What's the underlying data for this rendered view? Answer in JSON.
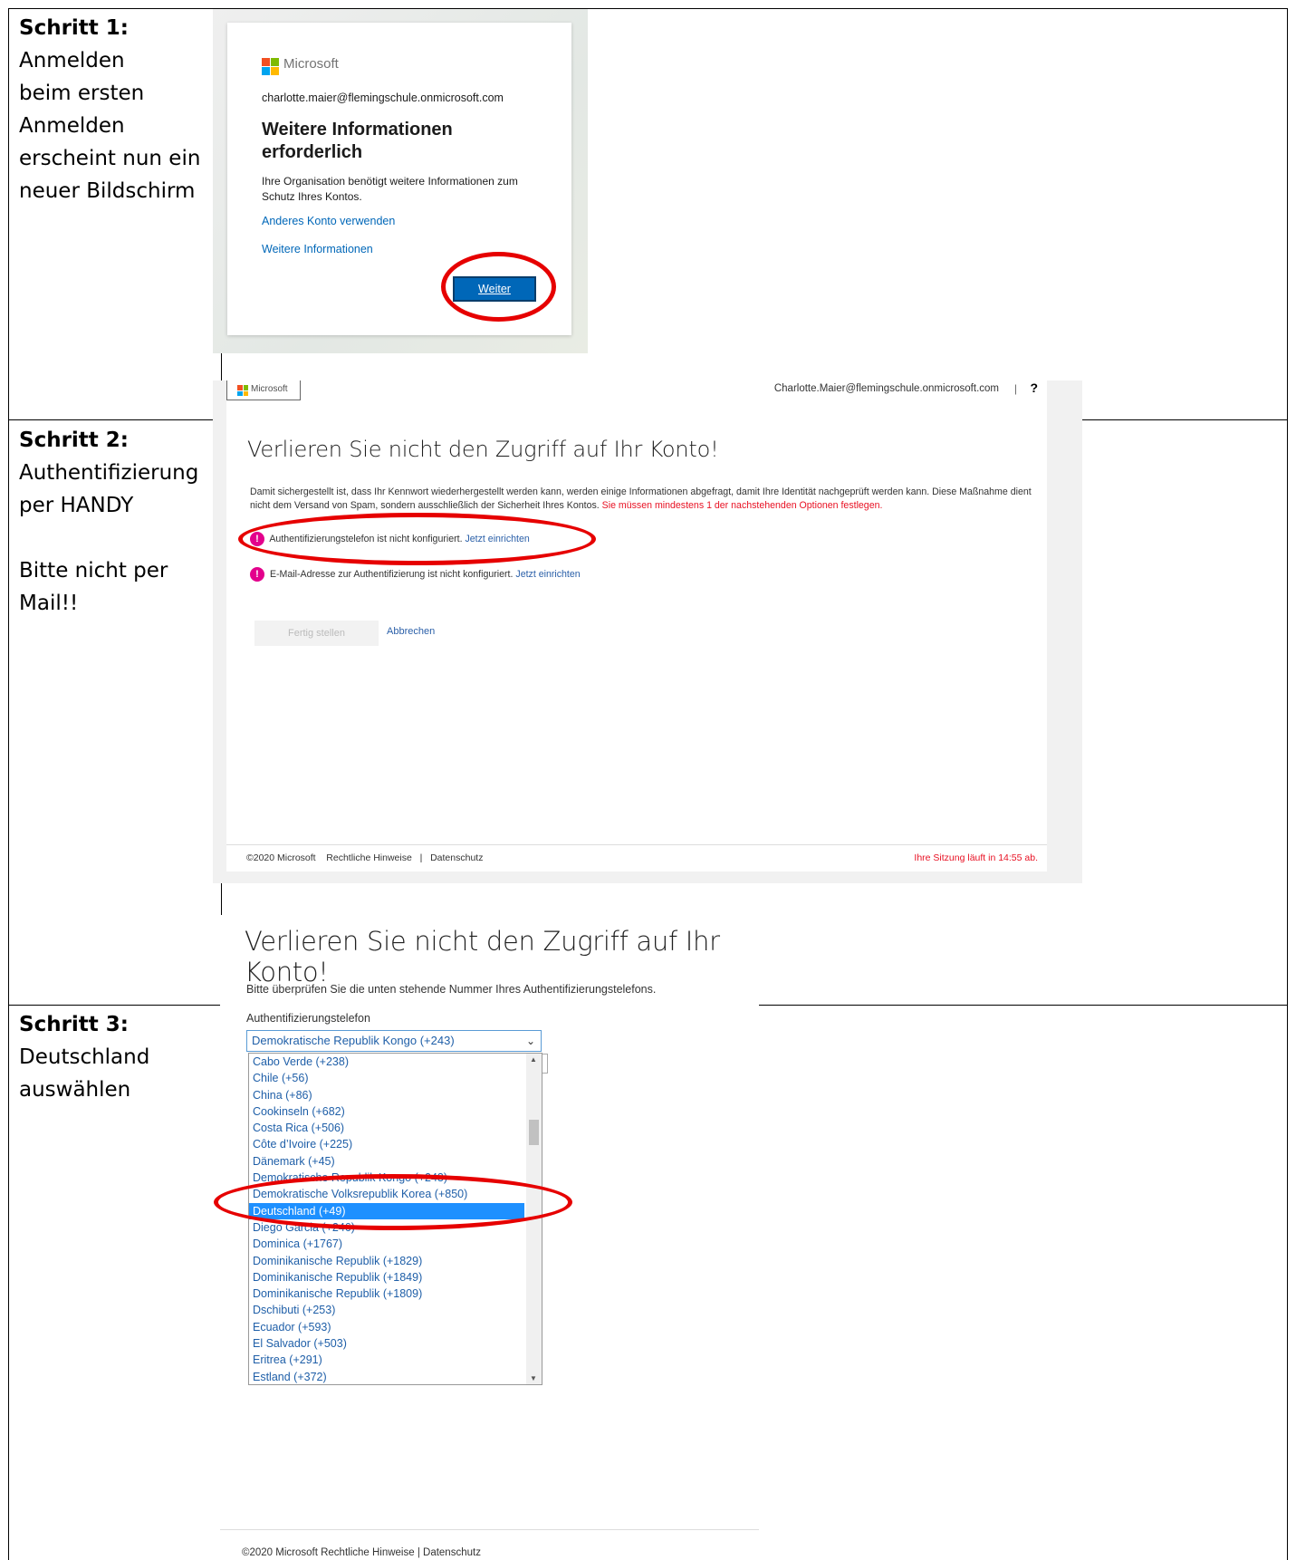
{
  "steps": [
    {
      "heading": "Schritt 1:",
      "lines": [
        "Anmelden",
        "beim ersten",
        "Anmelden",
        "erscheint nun ein",
        "neuer Bildschirm"
      ]
    },
    {
      "heading": "Schritt 2:",
      "lines": [
        "Authentifizierung",
        "per HANDY",
        "",
        "Bitte nicht per",
        "Mail!!"
      ]
    },
    {
      "heading": "Schritt 3:",
      "lines": [
        "Deutschland",
        "auswählen"
      ]
    }
  ],
  "signin": {
    "brand": "Microsoft",
    "email": "charlotte.maier@flemingschule.onmicrosoft.com",
    "title": "Weitere Informationen erforderlich",
    "description": "Ihre Organisation benötigt weitere Informationen zum Schutz Ihres Kontos.",
    "link_other_account": "Anderes Konto verwenden",
    "link_more_info": "Weitere Informationen",
    "next_button": "Weiter"
  },
  "proofup": {
    "brand": "Microsoft",
    "user": "Charlotte.Maier@flemingschule.onmicrosoft.com",
    "separator": "|",
    "help": "?",
    "title": "Verlieren Sie nicht den Zugriff auf Ihr Konto!",
    "description": "Damit sichergestellt ist, dass Ihr Kennwort wiederhergestellt werden kann, werden einige Informationen abgefragt, damit Ihre Identität nachgeprüft werden kann. Diese Maßnahme dient nicht dem Versand von Spam, sondern ausschließlich der Sicherheit Ihres Kontos.",
    "requirement": "Sie müssen mindestens 1 der nachstehenden Optionen festlegen.",
    "phone_status": "Authentifizierungstelefon ist nicht konfiguriert.",
    "phone_setup": "Jetzt einrichten",
    "email_status": "E-Mail-Adresse zur Authentifizierung ist nicht konfiguriert.",
    "email_setup": "Jetzt einrichten",
    "finish_button": "Fertig stellen",
    "cancel_button": "Abbrechen",
    "footer_copyright": "©2020 Microsoft",
    "footer_legal": "Rechtliche Hinweise",
    "footer_sep": "|",
    "footer_privacy": "Datenschutz",
    "session": "Ihre Sitzung läuft in 14:55 ab."
  },
  "phone": {
    "title": "Verlieren Sie nicht den Zugriff auf Ihr Konto!",
    "description": "Bitte überprüfen Sie die unten stehende Nummer Ihres Authentifizierungstelefons.",
    "label": "Authentifizierungstelefon",
    "selected": "Demokratische Republik Kongo (+243)",
    "options": [
      "Cabo Verde (+238)",
      "Chile (+56)",
      "China (+86)",
      "Cookinseln (+682)",
      "Costa Rica (+506)",
      "Côte d’Ivoire (+225)",
      "Dänemark (+45)",
      "Demokratische Republik Kongo (+243)",
      "Demokratische Volksrepublik Korea (+850)",
      "Deutschland (+49)",
      "Diego Garcia (+246)",
      "Dominica (+1767)",
      "Dominikanische Republik (+1829)",
      "Dominikanische Republik (+1849)",
      "Dominikanische Republik (+1809)",
      "Dschibuti (+253)",
      "Ecuador (+593)",
      "El Salvador (+503)",
      "Eritrea (+291)",
      "Estland (+372)"
    ],
    "highlighted_option": "Deutschland (+49)",
    "footer": "©2020 Microsoft   Rechtliche Hinweise   |   Datenschutz"
  },
  "colors": {
    "ms_red": "#f25022",
    "ms_green": "#7fba00",
    "ms_blue": "#00a4ef",
    "ms_yellow": "#ffb900",
    "link_blue": "#0067b8",
    "highlight_red": "#e60000",
    "select_blue": "#1e90ff"
  }
}
